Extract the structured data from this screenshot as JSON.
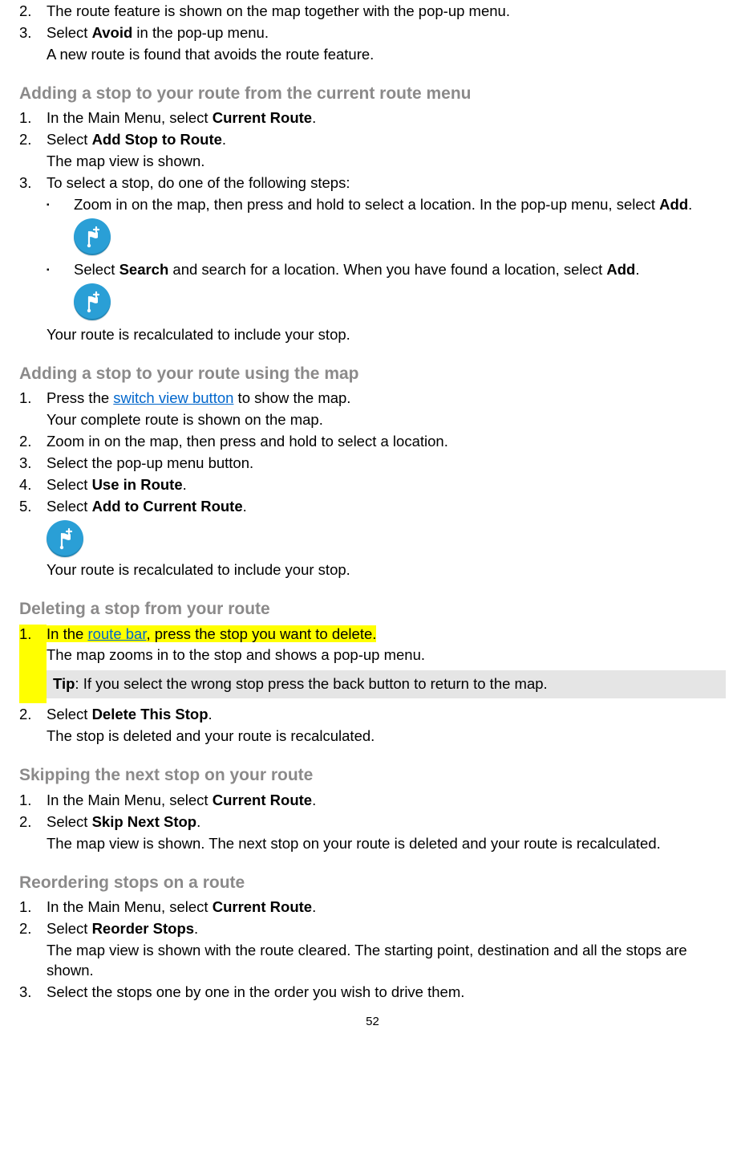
{
  "top_steps": [
    {
      "n": "2.",
      "text": "The route feature is shown on the map together with the pop-up menu."
    },
    {
      "n": "3.",
      "text_pre": "Select ",
      "bold": "Avoid",
      "text_post": " in the pop-up menu.",
      "sub": "A new route is found that avoids the route feature."
    }
  ],
  "s_add_menu": {
    "title": "Adding a stop to your route from the current route menu",
    "step1": {
      "n": "1.",
      "pre": "In the Main Menu, select ",
      "bold": "Current Route",
      "post": "."
    },
    "step2": {
      "n": "2.",
      "pre": "Select ",
      "bold": "Add Stop to Route",
      "post": ".",
      "sub": "The map view is shown."
    },
    "step3": {
      "n": "3.",
      "text": "To select a stop, do one of the following steps:"
    },
    "bullet1": {
      "pre": "Zoom in on the map, then press and hold to select a location. In the pop-up menu, select ",
      "bold": "Add",
      "post": "."
    },
    "bullet2": {
      "pre": "Select ",
      "b1": "Search",
      "mid": " and search for a location. When you have found a location, select ",
      "b2": "Add",
      "post": "."
    },
    "closing": "Your route is recalculated to include your stop."
  },
  "s_add_map": {
    "title": "Adding a stop to your route using the map",
    "step1": {
      "n": "1.",
      "pre": "Press the ",
      "link": "switch view button",
      "post": " to show the map.",
      "sub": "Your complete route is shown on the map."
    },
    "step2": {
      "n": "2.",
      "text": "Zoom in on the map, then press and hold to select a location."
    },
    "step3": {
      "n": "3.",
      "text": "Select the pop-up menu button."
    },
    "step4": {
      "n": "4.",
      "pre": "Select ",
      "bold": "Use in Route",
      "post": "."
    },
    "step5": {
      "n": "5.",
      "pre": "Select ",
      "bold": "Add to Current Route",
      "post": "."
    },
    "closing": "Your route is recalculated to include your stop."
  },
  "s_delete": {
    "title": "Deleting a stop from your route",
    "step1": {
      "n": "1.",
      "pre": "In the ",
      "link": "route bar",
      "post": ", press the stop you want to delete.",
      "sub": "The map zooms in to the stop and shows a pop-up menu."
    },
    "tip": {
      "label": "Tip",
      "text": ": If you select the wrong stop press the back button to return to the map."
    },
    "step2": {
      "n": "2.",
      "pre": "Select ",
      "bold": "Delete This Stop",
      "post": ".",
      "sub": "The stop is deleted and your route is recalculated."
    }
  },
  "s_skip": {
    "title": "Skipping the next stop on your route",
    "step1": {
      "n": "1.",
      "pre": "In the Main Menu, select ",
      "bold": "Current Route",
      "post": "."
    },
    "step2": {
      "n": "2.",
      "pre": "Select ",
      "bold": "Skip Next Stop",
      "post": ".",
      "sub": "The map view is shown. The next stop on your route is deleted and your route is recalculated."
    }
  },
  "s_reorder": {
    "title": "Reordering stops on a route",
    "step1": {
      "n": "1.",
      "pre": "In the Main Menu, select ",
      "bold": "Current Route",
      "post": "."
    },
    "step2": {
      "n": "2.",
      "pre": "Select ",
      "bold": "Reorder Stops",
      "post": ".",
      "sub": "The map view is shown with the route cleared. The starting point, destination and all the stops are shown."
    },
    "step3": {
      "n": "3.",
      "text": "Select the stops one by one in the order you wish to drive them."
    }
  },
  "page": "52",
  "icons": {
    "add_stop": "add-stop-flag-icon"
  }
}
